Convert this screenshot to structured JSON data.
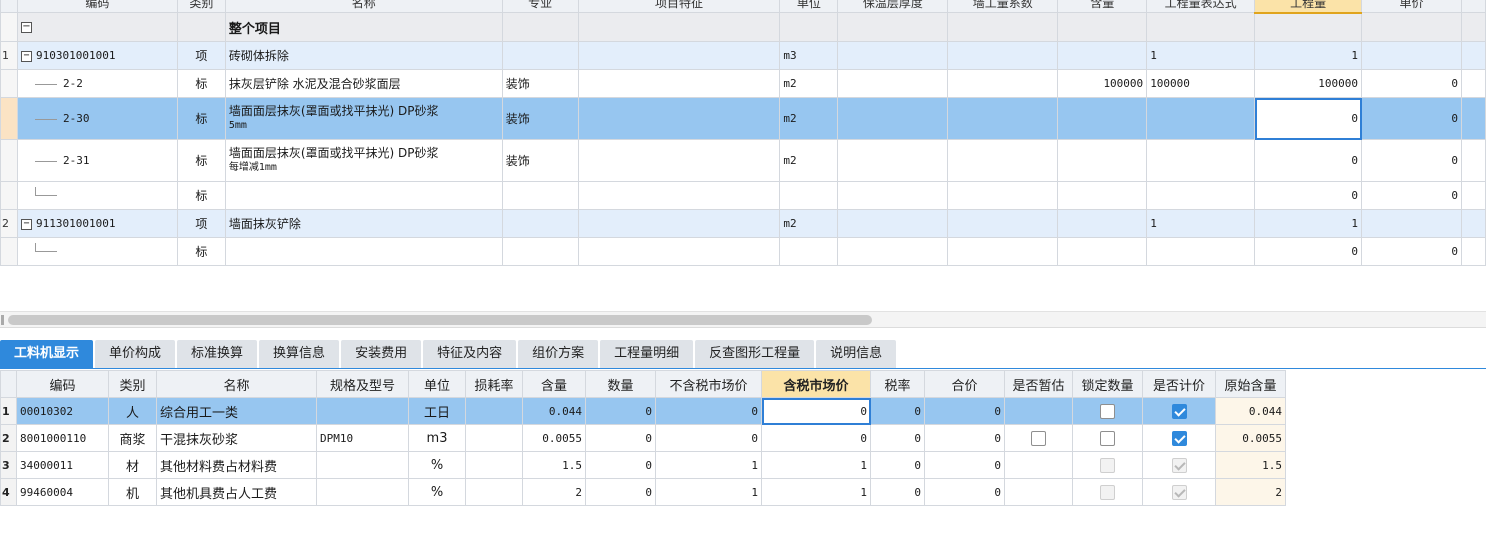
{
  "upper": {
    "headers": [
      "编码",
      "类别",
      "名称",
      "专业",
      "项目特征",
      "单位",
      "保温层厚度",
      "墙工量系数",
      "含量",
      "工程量表达式",
      "工程量",
      "单价"
    ],
    "rows": [
      {
        "num": "",
        "code": "",
        "type": "",
        "name": "整个项目",
        "spec": "",
        "feature": "",
        "unit": "",
        "thick": "",
        "coef": "",
        "content": "",
        "expr": "",
        "qty": "",
        "price": ""
      },
      {
        "num": "1",
        "code": "910301001001",
        "type": "项",
        "name": "砖砌体拆除",
        "spec": "",
        "feature": "",
        "unit": "m3",
        "thick": "",
        "coef": "",
        "content": "",
        "expr": "1",
        "qty": "1",
        "price": ""
      },
      {
        "num": "",
        "code": "2-2",
        "type": "标",
        "name": "抹灰层铲除 水泥及混合砂浆面层",
        "spec": "装饰",
        "feature": "",
        "unit": "m2",
        "thick": "",
        "coef": "",
        "content": "100000",
        "expr": "100000",
        "qty": "100000",
        "price": "0"
      },
      {
        "num": "",
        "code": "2-30",
        "type": "标",
        "name": "墙面面层抹灰(罩面或找平抹光) DP砂浆",
        "name_sub": "5mm",
        "spec": "装饰",
        "feature": "",
        "unit": "m2",
        "thick": "",
        "coef": "",
        "content": "",
        "expr": "",
        "qty": "0",
        "price": "0"
      },
      {
        "num": "",
        "code": "2-31",
        "type": "标",
        "name": "墙面面层抹灰(罩面或找平抹光) DP砂浆",
        "name_sub": "每增减1mm",
        "spec": "装饰",
        "feature": "",
        "unit": "m2",
        "thick": "",
        "coef": "",
        "content": "",
        "expr": "",
        "qty": "0",
        "price": "0"
      },
      {
        "num": "",
        "code": "",
        "type": "标",
        "name": "",
        "spec": "",
        "feature": "",
        "unit": "",
        "thick": "",
        "coef": "",
        "content": "",
        "expr": "",
        "qty": "0",
        "price": "0"
      },
      {
        "num": "2",
        "code": "911301001001",
        "type": "项",
        "name": "墙面抹灰铲除",
        "spec": "",
        "feature": "",
        "unit": "m2",
        "thick": "",
        "coef": "",
        "content": "",
        "expr": "1",
        "qty": "1",
        "price": ""
      },
      {
        "num": "",
        "code": "",
        "type": "标",
        "name": "",
        "spec": "",
        "feature": "",
        "unit": "",
        "thick": "",
        "coef": "",
        "content": "",
        "expr": "",
        "qty": "0",
        "price": "0"
      }
    ]
  },
  "tabs": [
    "工料机显示",
    "单价构成",
    "标准换算",
    "换算信息",
    "安装费用",
    "特征及内容",
    "组价方案",
    "工程量明细",
    "反查图形工程量",
    "说明信息"
  ],
  "lower": {
    "headers": [
      "",
      "编码",
      "类别",
      "名称",
      "规格及型号",
      "单位",
      "损耗率",
      "含量",
      "数量",
      "不含税市场价",
      "含税市场价",
      "税率",
      "合价",
      "是否暂估",
      "锁定数量",
      "是否计价",
      "原始含量"
    ],
    "rows": [
      {
        "num": "1",
        "code": "00010302",
        "type": "人",
        "name": "综合用工一类",
        "spec": "",
        "unit": "工日",
        "loss": "",
        "content": "0.044",
        "amount": "0",
        "price_ex": "0",
        "price_in": "0",
        "tax": "0",
        "total": "0",
        "est": null,
        "lock": false,
        "priced": true,
        "orig": "0.044"
      },
      {
        "num": "2",
        "code": "8001000110",
        "type": "商浆",
        "name": "干混抹灰砂浆",
        "spec": "DPM10",
        "unit": "m3",
        "loss": "",
        "content": "0.0055",
        "amount": "0",
        "price_ex": "0",
        "price_in": "0",
        "tax": "0",
        "total": "0",
        "est": false,
        "lock": false,
        "priced": true,
        "orig": "0.0055"
      },
      {
        "num": "3",
        "code": "34000011",
        "type": "材",
        "name": "其他材料费占材料费",
        "spec": "",
        "unit": "%",
        "loss": "",
        "content": "1.5",
        "amount": "0",
        "price_ex": "1",
        "price_in": "1",
        "tax": "0",
        "total": "0",
        "est": null,
        "lock": "dis",
        "priced": "dis",
        "orig": "1.5"
      },
      {
        "num": "4",
        "code": "99460004",
        "type": "机",
        "name": "其他机具费占人工费",
        "spec": "",
        "unit": "%",
        "loss": "",
        "content": "2",
        "amount": "0",
        "price_ex": "1",
        "price_in": "1",
        "tax": "0",
        "total": "0",
        "est": null,
        "lock": "dis",
        "priced": "dis",
        "orig": "2"
      }
    ]
  },
  "colors": {
    "accent": "#2f89dc",
    "selected_row": "#97c6f0",
    "active_header": "#fbe3a8"
  }
}
